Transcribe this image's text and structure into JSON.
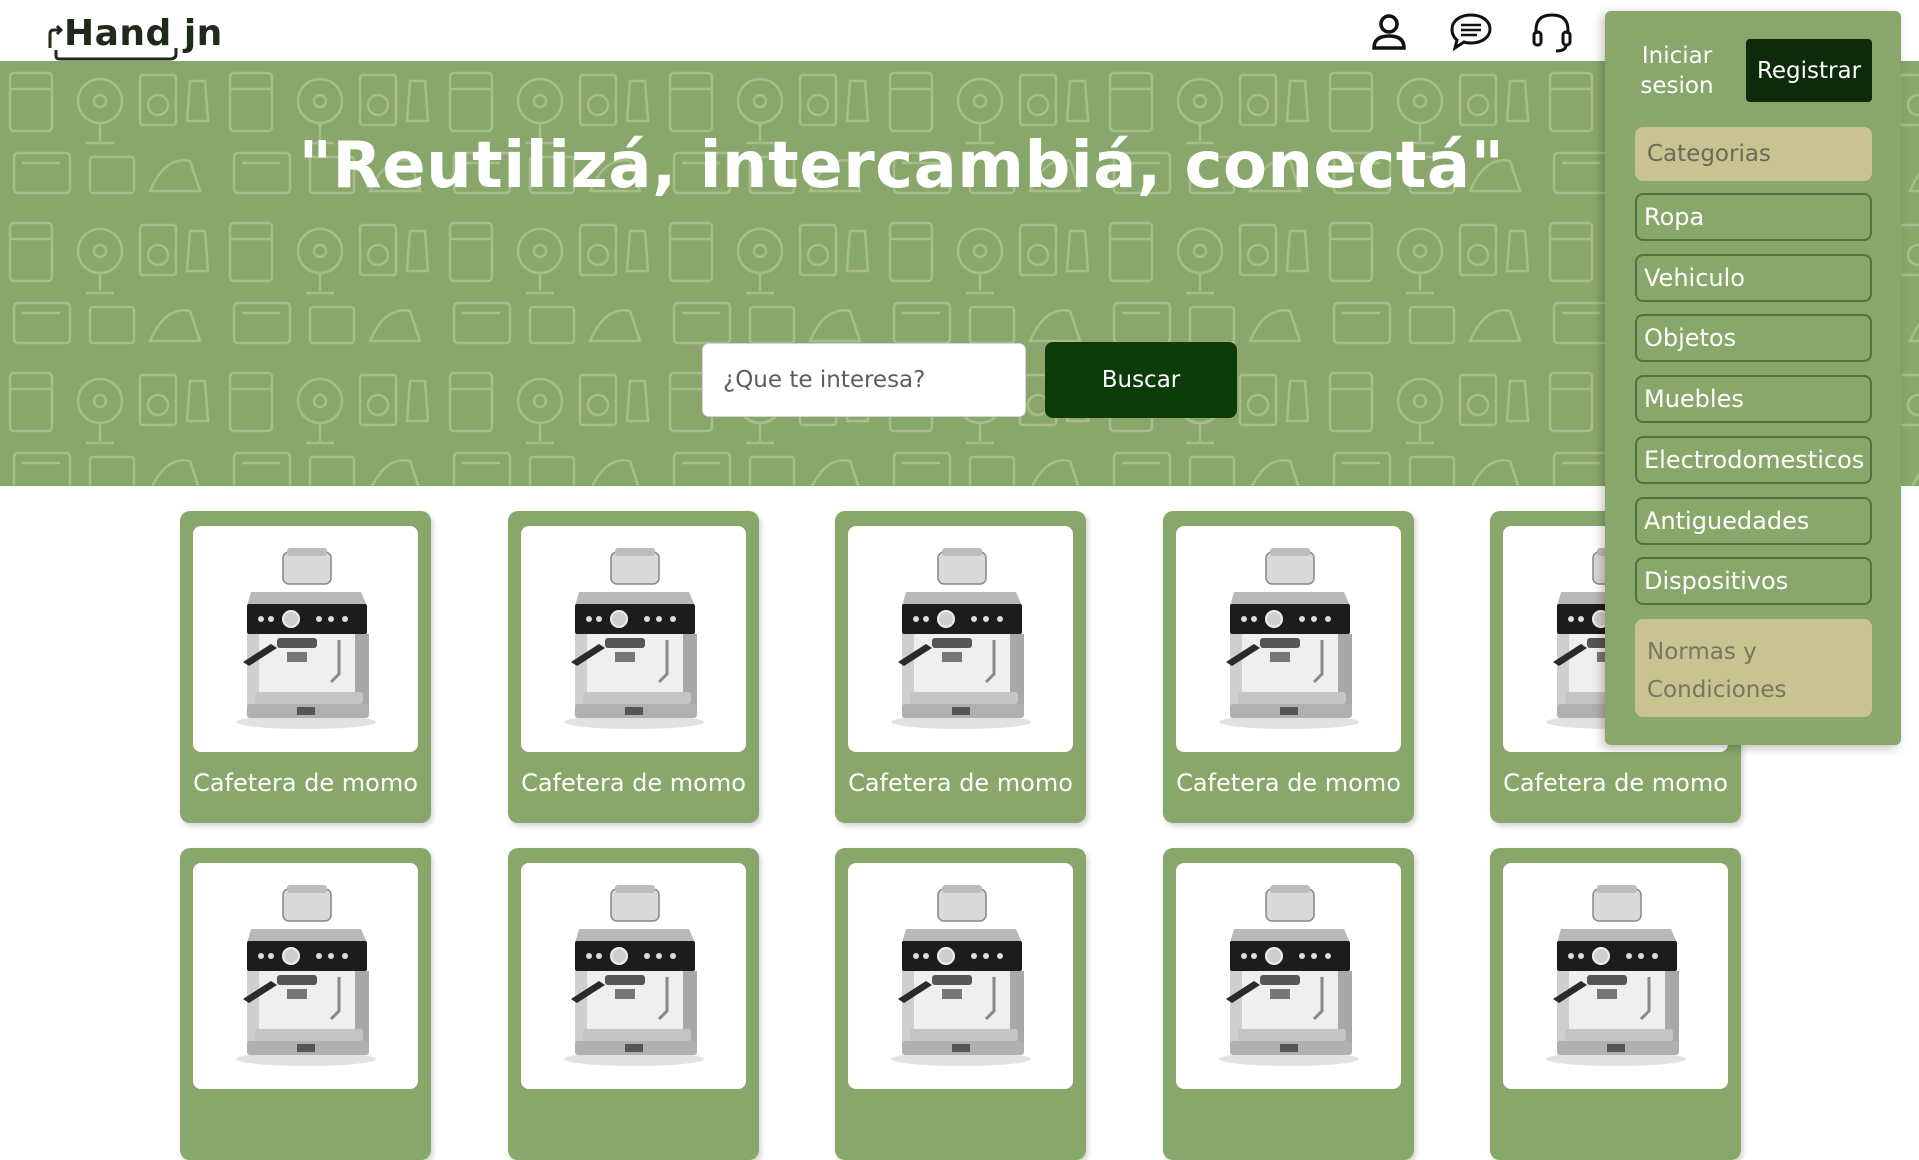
{
  "header": {
    "logo_text": "Hand",
    "logo_text_suffix": "jn",
    "icons": [
      "user-icon",
      "chat-icon",
      "headset-icon"
    ]
  },
  "hero": {
    "slogan": "\"Reutilizá, intercambiá, conectá\"",
    "search_placeholder": "¿Que te interesa?",
    "search_button": "Buscar"
  },
  "products": [
    {
      "label": "Cafetera de momo"
    },
    {
      "label": "Cafetera de momo"
    },
    {
      "label": "Cafetera de momo"
    },
    {
      "label": "Cafetera de momo"
    },
    {
      "label": "Cafetera de momo"
    },
    {
      "label": ""
    },
    {
      "label": ""
    },
    {
      "label": ""
    },
    {
      "label": ""
    },
    {
      "label": ""
    }
  ],
  "sidebar": {
    "login_label": "Iniciar sesion",
    "register_label": "Registrar",
    "categories_header": "Categorias",
    "categories": [
      "Ropa",
      "Vehiculo",
      "Objetos",
      "Muebles",
      "Electrodomesticos",
      "Antiguedades",
      "Dispositivos"
    ],
    "terms_label": "Normas y Condiciones"
  },
  "colors": {
    "brand_green": "#8aa76b",
    "dark_green": "#0d3b0a",
    "register_dark": "#0d2a0a",
    "sand": "#c9c291"
  }
}
